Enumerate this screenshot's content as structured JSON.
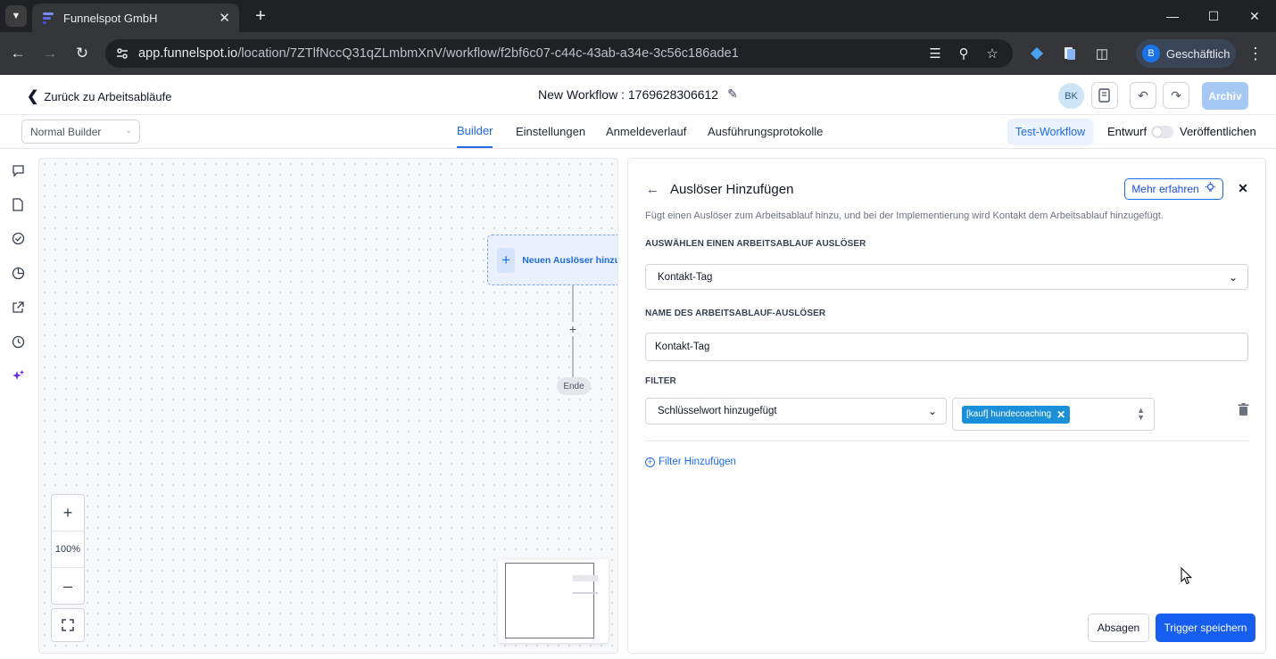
{
  "browser": {
    "tab_title": "Funnelspot GmbH",
    "url_host": "app.funnelspot.io",
    "url_path": "/location/7ZTlfNccQ31qZLmbmXnV/workflow/f2bf6c07-c44c-43ab-a34e-3c56c186ade1",
    "profile_initial": "B",
    "profile_label": "Geschäftlich"
  },
  "header": {
    "back_label": "Zurück zu Arbeitsabläufe",
    "workflow_title": "New Workflow : 1769628306612",
    "avatar_initials": "BK",
    "archive_label": "Archiv"
  },
  "subheader": {
    "builder_mode": "Normal Builder",
    "tabs": [
      {
        "label": "Builder",
        "active": true
      },
      {
        "label": "Einstellungen",
        "active": false
      },
      {
        "label": "Anmeldeverlauf",
        "active": false
      },
      {
        "label": "Ausführungsprotokolle",
        "active": false
      }
    ],
    "test_workflow_label": "Test-Workflow",
    "draft_label": "Entwurf",
    "publish_label": "Veröffentlichen",
    "published": false
  },
  "canvas": {
    "trigger_node_label": "Neuen Auslöser hinzufü",
    "end_label": "Ende",
    "zoom_level": "100%"
  },
  "panel": {
    "title": "Auslöser Hinzufügen",
    "learn_more_label": "Mehr erfahren",
    "description": "Fügt einen Auslöser zum Arbeitsablauf hinzu, und bei der Implementierung wird Kontakt dem Arbeitsablauf hinzugefügt.",
    "trigger_select_label": "AUSWÄHLEN EINEN ARBEITSABLAUF AUSLÖSER",
    "trigger_select_value": "Kontakt-Tag",
    "trigger_name_label": "NAME DES ARBEITSABLAUF-AUSLÖSER",
    "trigger_name_value": "Kontakt-Tag",
    "filter_label": "FILTER",
    "filter_field_value": "Schlüsselwort hinzugefügt",
    "filter_tag": "[kauf] hundecoaching",
    "add_filter_label": "Filter Hinzufügen",
    "cancel_label": "Absagen",
    "save_label": "Trigger speichern"
  },
  "colors": {
    "accent": "#155eef",
    "chip": "#1b90d8",
    "archive_disabled": "#a5c8f4"
  }
}
